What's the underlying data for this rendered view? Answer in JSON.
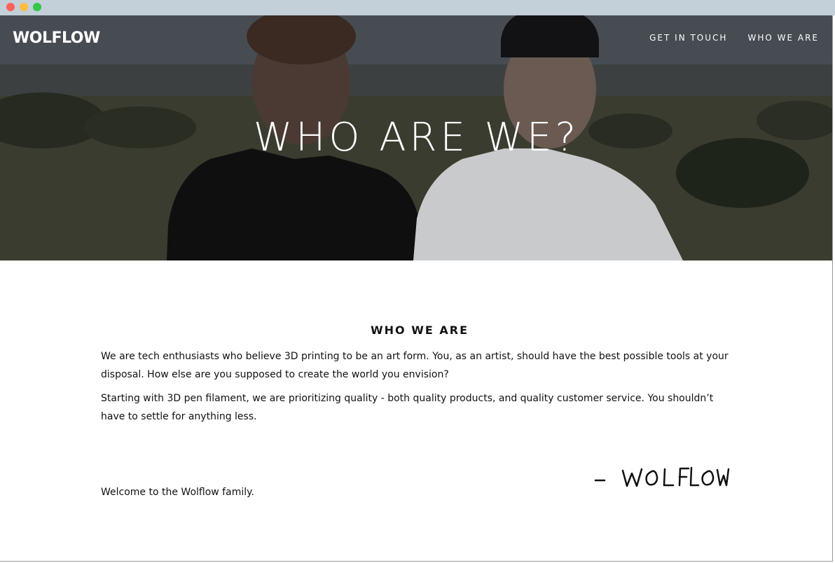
{
  "window": {
    "controls": [
      "close",
      "minimize",
      "zoom"
    ]
  },
  "header": {
    "logo": "WOLFLOW",
    "nav": [
      {
        "label": "GET IN TOUCH"
      },
      {
        "label": "WHO WE ARE"
      }
    ]
  },
  "hero": {
    "title": "WHO ARE WE?"
  },
  "about": {
    "heading": "WHO WE ARE",
    "paragraphs": [
      "We are tech enthusiasts who believe 3D printing to be an art form. You, as an artist, should have the best possible tools at your disposal. How else are you supposed to create the world you envision?",
      "Starting with 3D pen filament, we are prioritizing quality - both quality products, and quality customer service. You shouldn’t have to settle for anything less."
    ],
    "closing": "Welcome to the Wolflow family.",
    "signature": "- WOLFLOW"
  },
  "colors": {
    "chrome": "#c3cfd9",
    "close": "#fc605c",
    "minimize": "#fdbc40",
    "zoom": "#34c749",
    "text": "#111111"
  }
}
